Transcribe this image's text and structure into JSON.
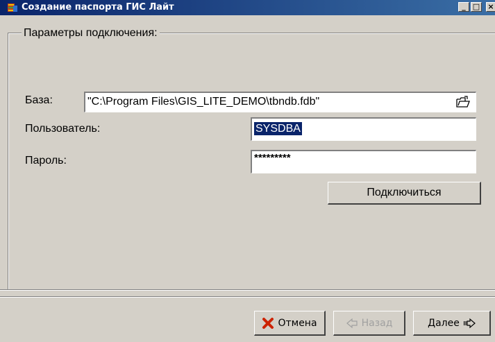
{
  "window": {
    "title": "Создание паспорта ГИС Лайт",
    "minimize": "_",
    "maximize": "□",
    "close": "×"
  },
  "group": {
    "title": "Параметры подключения:"
  },
  "form": {
    "base_label": "База:",
    "base_value": "\"C:\\Program Files\\GIS_LITE_DEMO\\tbndb.fdb\"",
    "user_label": "Пользователь:",
    "user_value": "SYSDBA",
    "password_label": "Пароль:",
    "password_value": "*********",
    "connect_label": "Подключиться"
  },
  "footer": {
    "cancel_label": "Отмена",
    "back_label": "Назад",
    "next_label": "Далее"
  },
  "icons": {
    "app": "database-icon",
    "browse": "open-folder-icon",
    "cancel": "red-x-icon",
    "back": "arrow-left-icon",
    "next": "arrow-right-icon"
  },
  "colors": {
    "titlebar": "#0a246a",
    "face": "#d4d0c8",
    "selection": "#0a246a",
    "cancel_x": "#cc2200"
  }
}
